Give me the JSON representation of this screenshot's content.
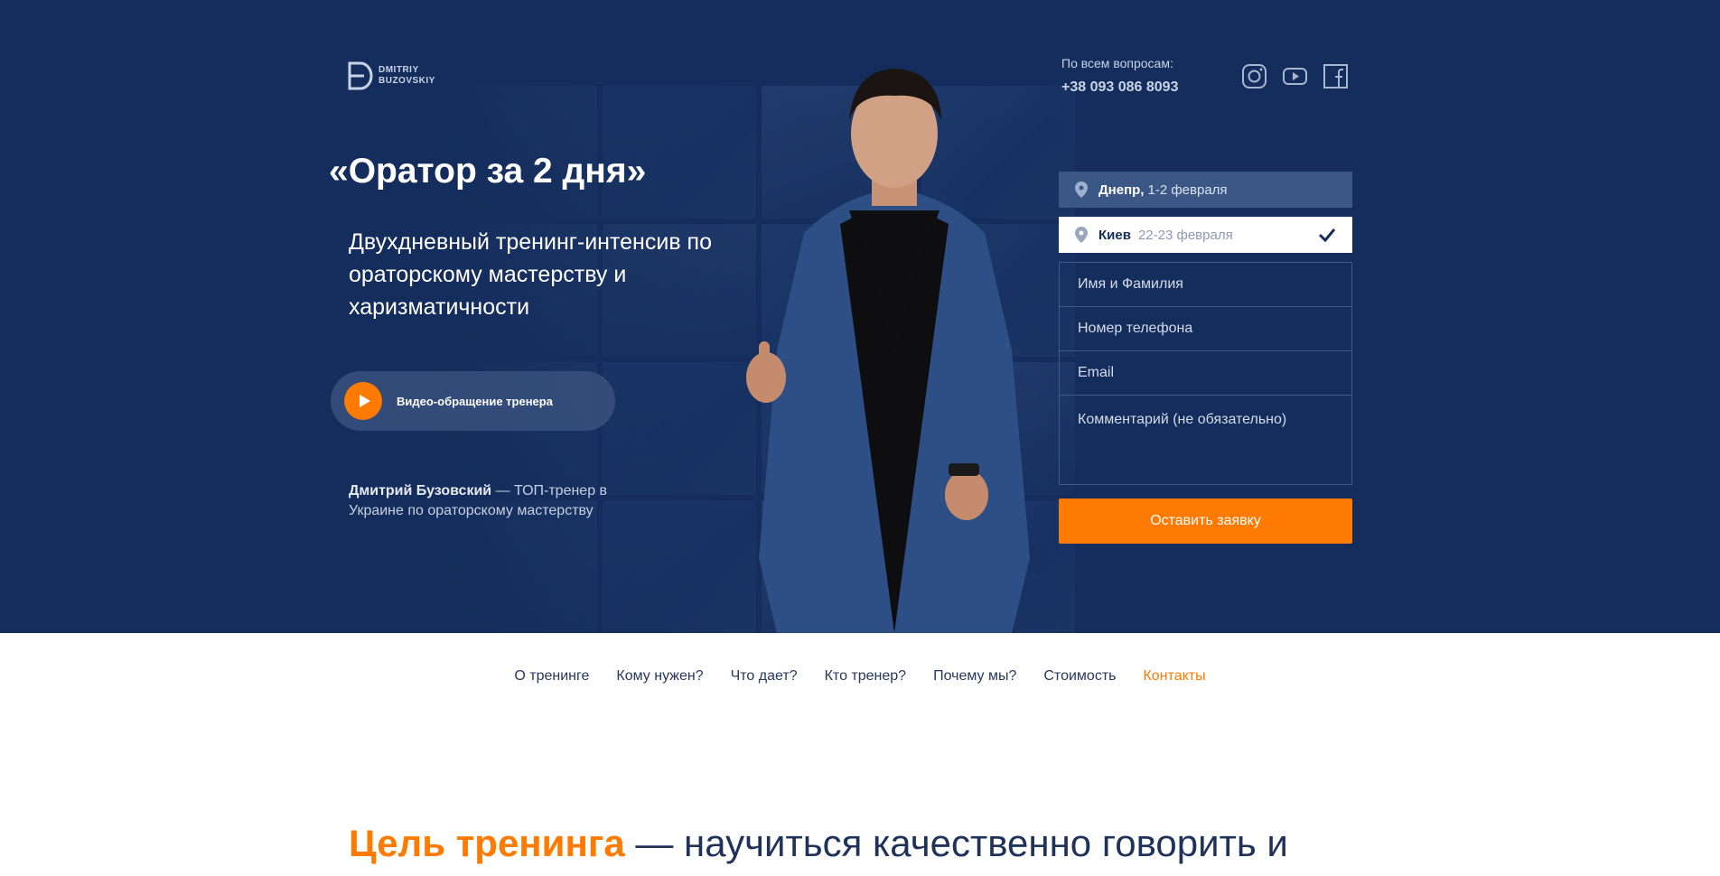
{
  "brand": {
    "logo_line1": "DMITRIY",
    "logo_line2": "BUZOVSKIY"
  },
  "contact": {
    "label": "По всем вопросам:",
    "phone": "+38 093 086 8093"
  },
  "socials": [
    {
      "icon": "instagram-icon"
    },
    {
      "icon": "youtube-icon"
    },
    {
      "icon": "facebook-icon"
    }
  ],
  "hero": {
    "title": "«Оратор за 2 дня»",
    "subtitle": "Двухдневный тренинг-интенсив по ораторскому мастерству и харизматичности",
    "video_button": "Видео-обращение тренера",
    "trainer_name": "Дмитрий Бузовский",
    "trainer_desc": " — ТОП-тренер в Украине по ораторскому мастерству"
  },
  "form": {
    "cities": [
      {
        "city": "Днепр,",
        "date": "1-2 февраля",
        "selected": false
      },
      {
        "city": "Киев",
        "date": "22-23 февраля",
        "selected": true
      }
    ],
    "name_placeholder": "Имя и Фамилия",
    "phone_placeholder": "Номер телефона",
    "email_placeholder": "Email",
    "comment_placeholder": "Комментарий (не обязательно)",
    "submit_label": "Оставить заявку"
  },
  "nav": {
    "items": [
      {
        "label": "О тренинге",
        "active": false
      },
      {
        "label": "Кому нужен?",
        "active": false
      },
      {
        "label": "Что дает?",
        "active": false
      },
      {
        "label": "Кто тренер?",
        "active": false
      },
      {
        "label": "Почему мы?",
        "active": false
      },
      {
        "label": "Стоимость",
        "active": false
      },
      {
        "label": "Контакты",
        "active": true
      }
    ]
  },
  "goal": {
    "accent": "Цель тренинга",
    "rest": " — научиться качественно говорить и"
  },
  "colors": {
    "hero_bg": "#142d5c",
    "accent": "#ff7a00",
    "text_dark": "#25385d"
  }
}
